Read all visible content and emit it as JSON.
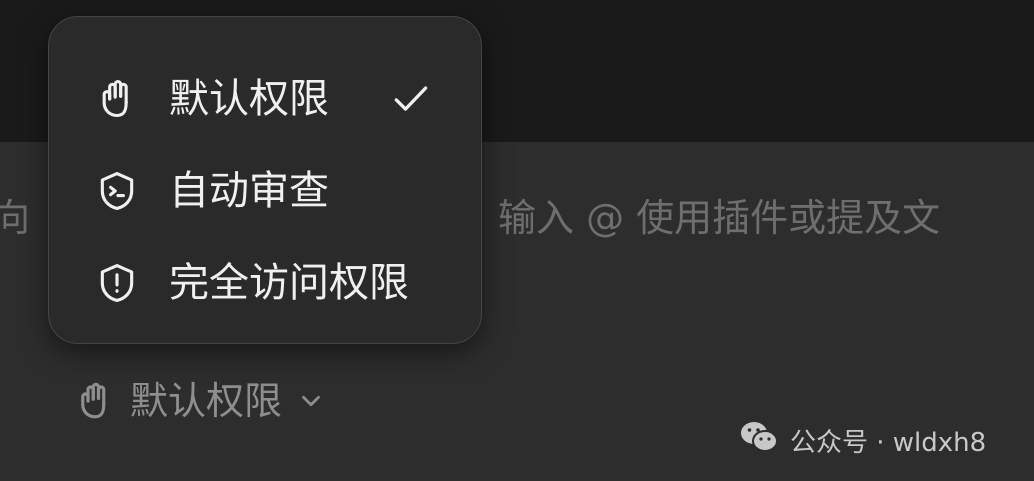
{
  "composer": {
    "prompt_left_fragment": "向",
    "prompt_right_fragment": "输入 @ 使用插件或提及文"
  },
  "permission_button": {
    "label": "默认权限",
    "icon": "hand-icon",
    "dropdown_icon": "chevron-down-icon"
  },
  "permission_menu": {
    "items": [
      {
        "label": "默认权限",
        "icon": "hand-icon",
        "selected": true
      },
      {
        "label": "自动审查",
        "icon": "terminal-shield-icon",
        "selected": false
      },
      {
        "label": "完全访问权限",
        "icon": "warning-shield-icon",
        "selected": false
      }
    ],
    "check_icon": "checkmark-icon"
  },
  "watermark": {
    "text": "公众号 · wldxh8",
    "icon": "wechat-icon"
  },
  "colors": {
    "background_top": "#1a1a1a",
    "composer_bg": "#2d2d2d",
    "menu_bg": "#2a2a2a",
    "menu_border": "#444444",
    "menu_text": "#f0f0f0",
    "muted_text": "#8e8e8e",
    "placeholder_text": "#6e6e6e"
  }
}
